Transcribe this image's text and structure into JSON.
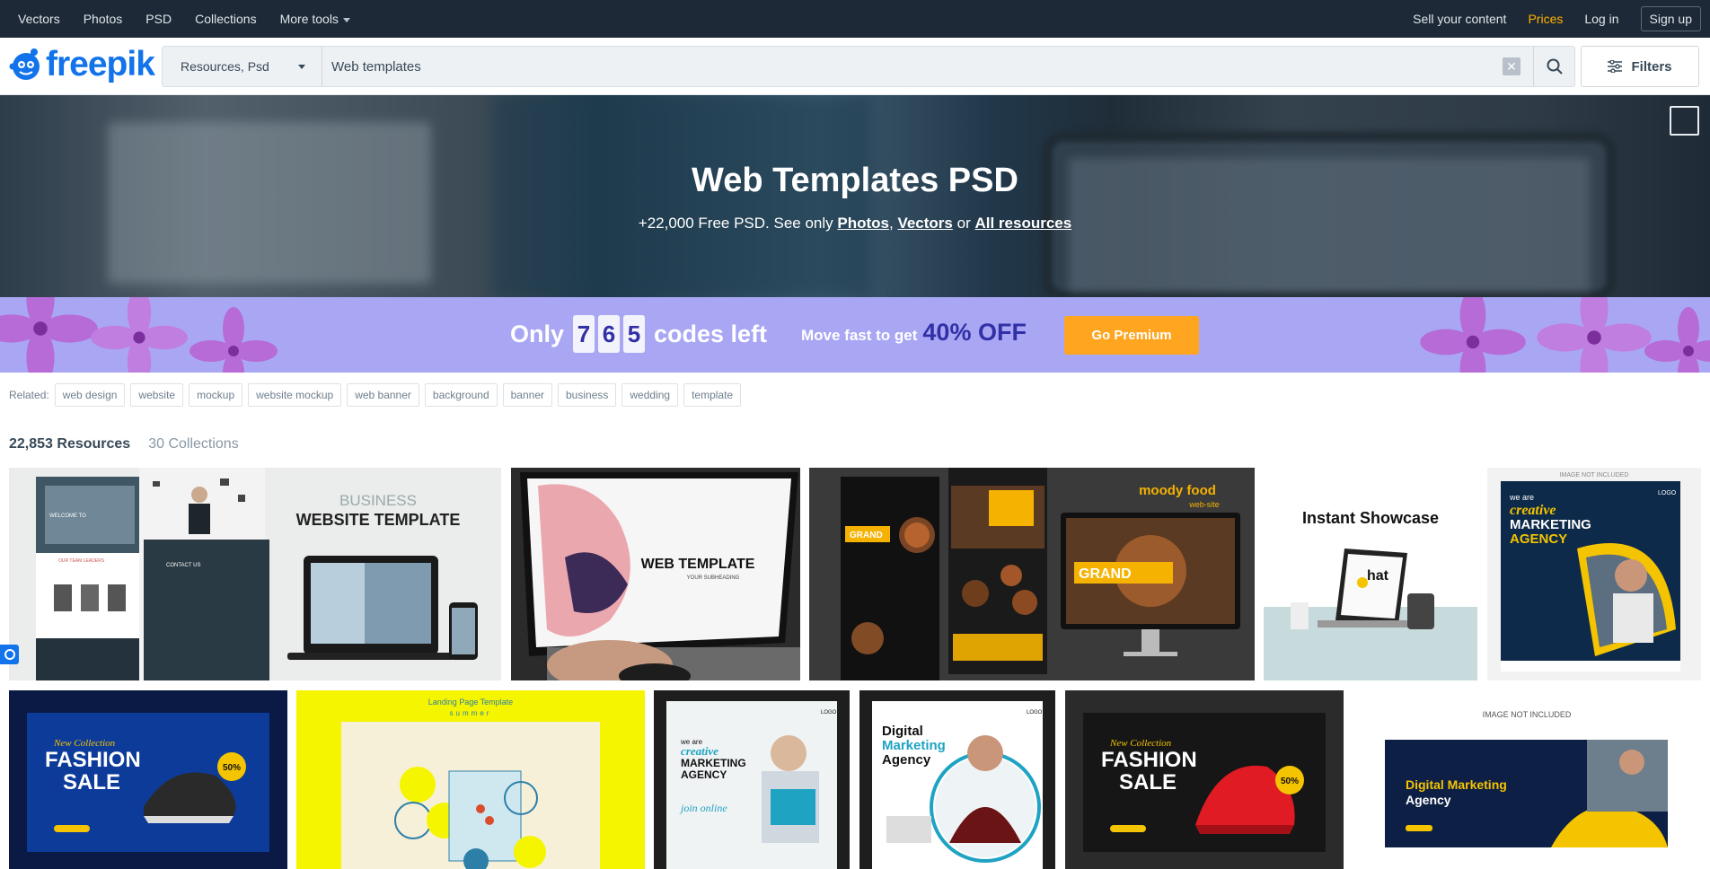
{
  "topnav": {
    "left_items": [
      "Vectors",
      "Photos",
      "PSD",
      "Collections",
      "More tools"
    ],
    "sell": "Sell your content",
    "prices": "Prices",
    "login": "Log in",
    "signup": "Sign up"
  },
  "header": {
    "logo": "freepik",
    "search_type": "Resources, Psd",
    "search_value": "Web templates",
    "filters_label": "Filters"
  },
  "hero": {
    "title": "Web Templates PSD",
    "subtitle_prefix": "+22,000 Free PSD. See only",
    "link_photos": "Photos",
    "link_vectors": "Vectors",
    "or": "or",
    "link_all": "All resources"
  },
  "promo": {
    "only": "Only",
    "digits": [
      "7",
      "6",
      "5"
    ],
    "codes_left": "codes left",
    "move_fast": "Move fast to get",
    "discount": "40% OFF",
    "cta": "Go Premium"
  },
  "related": {
    "label": "Related:",
    "tags": [
      "web design",
      "website",
      "mockup",
      "website mockup",
      "web banner",
      "background",
      "banner",
      "business",
      "wedding",
      "template"
    ]
  },
  "results": {
    "resources": "22,853 Resources",
    "collections": "30 Collections"
  },
  "thumbs": {
    "t1": {
      "title1": "BUSINESS",
      "title2": "WEBSITE TEMPLATE",
      "sub1": "OUR TEAM LEADERS",
      "sub2": "CONTACT US",
      "sub3": "WELCOME TO"
    },
    "t2": {
      "title": "WEB TEMPLATE",
      "sub": "YOUR SUBHEADING"
    },
    "t3": {
      "title": "moody food",
      "sub": "web-site",
      "grand": "GRAND"
    },
    "t4": {
      "title": "Instant Showcase",
      "hat": "hat"
    },
    "t5": {
      "note": "IMAGE NOT INCLUDED",
      "l1": "we are",
      "l2": "creative",
      "l3": "MARKETING",
      "l4": "AGENCY",
      "logo": "LOGO"
    },
    "t6": {
      "l1": "New Collection",
      "l2": "FASHION",
      "l3": "SALE",
      "badge": "50%"
    },
    "t7": {
      "l1": "Landing Page Template",
      "l2": "summer"
    },
    "t8": {
      "l1": "we are",
      "l2": "creative",
      "l3": "MARKETING",
      "l4": "AGENCY",
      "l5": "join online",
      "logo": "LOGO"
    },
    "t9": {
      "l1": "Digital",
      "l2": "Marketing",
      "l3": "Agency",
      "logo": "LOGO"
    },
    "t10": {
      "l1": "New Collection",
      "l2": "FASHION",
      "l3": "SALE",
      "badge": "50%"
    },
    "t11": {
      "note": "IMAGE NOT INCLUDED",
      "l1": "Digital Marketing",
      "l2": "Agency"
    }
  }
}
